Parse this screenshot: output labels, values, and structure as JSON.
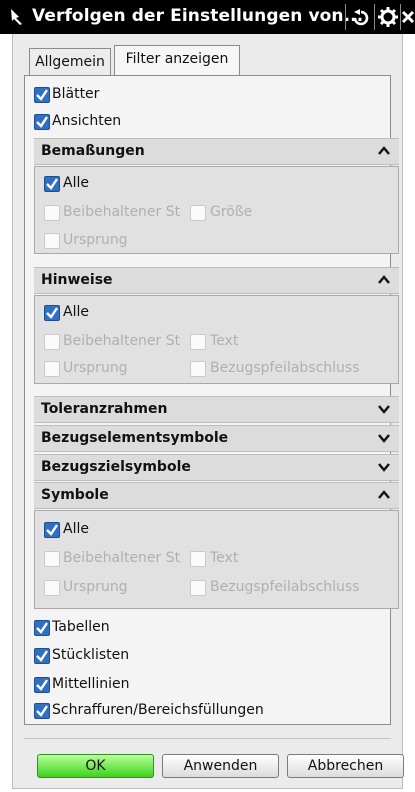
{
  "titlebar": {
    "title": "Verfolgen der Einstellungen von..."
  },
  "tabs": [
    {
      "label": "Allgemein",
      "active": false
    },
    {
      "label": "Filter anzeigen",
      "active": true
    }
  ],
  "top_checks": [
    {
      "label": "Blätter",
      "checked": true
    },
    {
      "label": "Ansichten",
      "checked": true
    }
  ],
  "sections": {
    "bemassungen": {
      "title": "Bemaßungen",
      "expanded": true,
      "alle": "Alle",
      "beibehalten": "Beibehaltener St",
      "groesse": "Größe",
      "ursprung": "Ursprung"
    },
    "hinweise": {
      "title": "Hinweise",
      "expanded": true,
      "alle": "Alle",
      "beibehalten": "Beibehaltener St",
      "text": "Text",
      "ursprung": "Ursprung",
      "bezug": "Bezugspfeilabschluss"
    },
    "toleranz": {
      "title": "Toleranzrahmen",
      "expanded": false
    },
    "bezugselement": {
      "title": "Bezugselementsymbole",
      "expanded": false
    },
    "bezugsziel": {
      "title": "Bezugszielsymbole",
      "expanded": false
    },
    "symbole": {
      "title": "Symbole",
      "expanded": true,
      "alle": "Alle",
      "beibehalten": "Beibehaltener St",
      "text": "Text",
      "ursprung": "Ursprung",
      "bezug": "Bezugspfeilabschluss"
    }
  },
  "bottom_checks": [
    {
      "label": "Tabellen",
      "checked": true
    },
    {
      "label": "Stücklisten",
      "checked": true
    },
    {
      "label": "Mittellinien",
      "checked": true
    },
    {
      "label": "Schraffuren/Bereichsfüllungen",
      "checked": true
    }
  ],
  "buttons": {
    "ok": "OK",
    "apply": "Anwenden",
    "cancel": "Abbrechen"
  },
  "colors": {
    "accent": "#2f6fc4",
    "ok_button": "#3fd21a",
    "titlebar": "#000000"
  },
  "icons": [
    "pin-icon",
    "reset-icon",
    "settings-gear-icon",
    "close-icon",
    "checkmark-icon",
    "chevron-up-icon",
    "chevron-down-icon"
  ]
}
